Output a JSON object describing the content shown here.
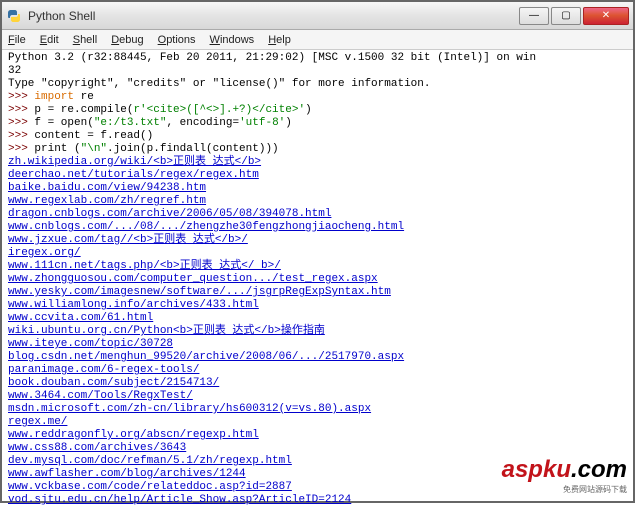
{
  "window": {
    "title": "Python Shell",
    "min": "—",
    "max": "▢",
    "close": "✕"
  },
  "menu": {
    "file": "File",
    "edit": "Edit",
    "shell": "Shell",
    "debug": "Debug",
    "options": "Options",
    "windows": "Windows",
    "help": "Help"
  },
  "header": {
    "line1": "Python 3.2 (r32:88445, Feb 20 2011, 21:29:02) [MSC v.1500 32 bit (Intel)] on win",
    "line2": "32",
    "line3": "Type \"copyright\", \"credits\" or \"license()\" for more information."
  },
  "prompt": ">>> ",
  "code": {
    "l1_a": "import",
    "l1_b": " re",
    "l2_a": "p = re.compile(",
    "l2_b": "r'<cite>([^<>].+?)</cite>'",
    "l2_c": ")",
    "l3_a": "f = open(",
    "l3_b": "\"e:/t3.txt\"",
    "l3_c": ", encoding=",
    "l3_d": "'utf-8'",
    "l3_e": ")",
    "l4": "content = f.read()",
    "l5_a": "print (",
    "l5_b": "\"\\n\"",
    "l5_c": ".join(p.findall(content)))"
  },
  "output": [
    "zh.wikipedia.org/wiki/<b>正则表 达式</b>",
    "deerchao.net/tutorials/regex/regex.htm",
    "baike.baidu.com/view/94238.htm",
    "www.regexlab.com/zh/regref.htm",
    "dragon.cnblogs.com/archive/2006/05/08/394078.html",
    "www.cnblogs.com/.../08/.../zhengzhe30fengzhongjiaocheng.html",
    "www.jzxue.com/tag//<b>正则表 达式</b>/",
    "iregex.org/",
    "www.111cn.net/tags.php/<b>正则表 达式</ b>/",
    "www.zhongguosou.com/computer_question.../test_regex.aspx",
    "www.yesky.com/imagesnew/software/.../jsgrpRegExpSyntax.htm",
    "www.williamlong.info/archives/433.html",
    "www.ccvita.com/61.html",
    "wiki.ubuntu.org.cn/Python<b>正则表 达式</b>操作指南",
    "www.iteye.com/topic/30728",
    "blog.csdn.net/menghun_99520/archive/2008/06/.../2517970.aspx",
    "paranimage.com/6-regex-tools/",
    "book.douban.com/subject/2154713/",
    "www.3464.com/Tools/RegxTest/",
    "msdn.microsoft.com/zh-cn/library/hs600312(v=vs.80).aspx",
    "regex.me/",
    "www.reddragonfly.org/abscn/regexp.html",
    "www.css88.com/archives/3643",
    "dev.mysql.com/doc/refman/5.1/zh/regexp.html",
    "www.awflasher.com/blog/archives/1244",
    "www.vckbase.com/code/relateddoc.asp?id=2887",
    "vod.sjtu.edu.cn/help/Article_Show.asp?ArticleID=2124"
  ],
  "watermark": {
    "logo_a": "asp",
    "logo_b": "ku",
    "logo_c": ".com",
    "sub": "免费网站源码下载"
  }
}
